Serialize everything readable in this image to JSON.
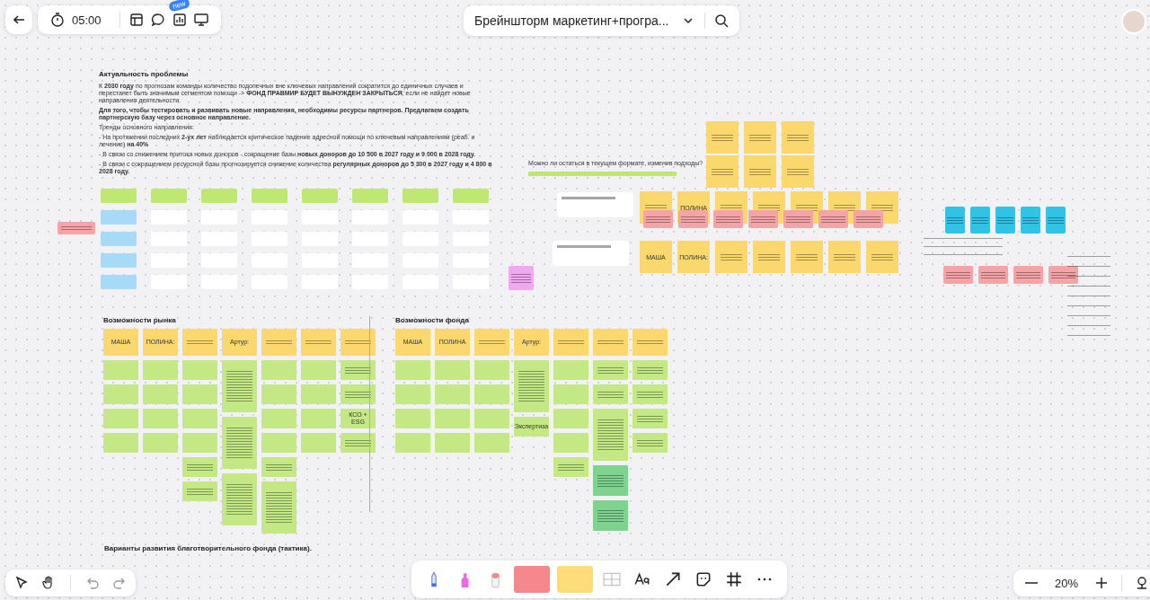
{
  "top_bar": {
    "timer": "05:00",
    "new_badge": "new",
    "board_title": "Брейншторм маркетинг+програ..."
  },
  "problem": {
    "heading": "Актуальность проблемы",
    "paragraphs": [
      "К **2030 году** по прогнозам команды количество подопечных вне ключевых направлений сократится до единичных случаев и перестанет быть значимым сегментом помощи -> **ФОНД ПРАВМИР БУДЕТ ВЫНУЖДЕН ЗАКРЫТЬСЯ**, если не найдет новые направления деятельности.",
      "**Для того, чтобы тестировать и развивать новые направления, необходимы ресурсы партнеров. Предлагаем создать партнерскую базу через основное направление.**",
      "Тренды основного направления:",
      "- На протяжении последних **2-ух лет** наблюдается критическое падение адресной помощи по ключевым направлениям (реаб. и лечение) **на 40%**",
      "- В связи со снижением притока новых доноров - сокращение базы **новых доноров до 10 500 в 2027 году и 9 000 в 2028 году.**",
      "- В связи с сокращением ресурсной базы прогнозируется снижение количества **регулярных доноров до 5 300 в 2027 году и 4 800 в 2028 году.**"
    ]
  },
  "question": {
    "title": "Можно ли остаться в текущем формате, изменив подходы?"
  },
  "market": {
    "heading": "Возможности рынка",
    "columns": [
      {
        "name": "МАША",
        "notes": [
          {
            "kind": "blank"
          },
          {
            "kind": "blank"
          },
          {
            "kind": "blank"
          },
          {
            "kind": "blank"
          }
        ]
      },
      {
        "name": "ПОЛИНА:",
        "notes": [
          {
            "kind": "blank"
          },
          {
            "kind": "blank"
          },
          {
            "kind": "blank"
          },
          {
            "kind": "blank"
          }
        ]
      },
      {
        "notes": [
          {
            "kind": "blank"
          },
          {
            "kind": "blank"
          },
          {
            "kind": "blank"
          },
          {
            "kind": "blank"
          },
          {
            "kind": "scribble"
          },
          {
            "kind": "scribble"
          }
        ]
      },
      {
        "name": "Артур:",
        "notes": [
          {
            "kind": "long"
          },
          {
            "kind": "long"
          },
          {
            "kind": "long"
          }
        ]
      },
      {
        "notes": [
          {
            "kind": "blank"
          },
          {
            "kind": "blank"
          },
          {
            "kind": "blank"
          },
          {
            "kind": "blank"
          },
          {
            "kind": "scribble"
          },
          {
            "kind": "long"
          }
        ]
      },
      {
        "notes": [
          {
            "kind": "blank"
          },
          {
            "kind": "blank"
          },
          {
            "kind": "blank"
          },
          {
            "kind": "blank"
          }
        ]
      },
      {
        "notes": [
          {
            "kind": "scribble"
          },
          {
            "kind": "scribble"
          },
          {
            "kind": "text",
            "text": "КСО + ESG"
          },
          {
            "kind": "scribble"
          }
        ]
      }
    ]
  },
  "fund": {
    "heading": "Возможности фонда",
    "columns": [
      {
        "name": "МАША",
        "notes": [
          {
            "kind": "blank"
          },
          {
            "kind": "blank"
          },
          {
            "kind": "blank"
          },
          {
            "kind": "blank"
          }
        ]
      },
      {
        "name": "ПОЛИНА",
        "notes": [
          {
            "kind": "blank"
          },
          {
            "kind": "blank"
          },
          {
            "kind": "blank"
          },
          {
            "kind": "blank"
          }
        ]
      },
      {
        "notes": [
          {
            "kind": "blank"
          },
          {
            "kind": "blank"
          },
          {
            "kind": "blank"
          },
          {
            "kind": "blank"
          }
        ]
      },
      {
        "name": "Артур:",
        "notes": [
          {
            "kind": "long"
          },
          {
            "kind": "text",
            "text": "Экспертиза"
          }
        ]
      },
      {
        "notes": [
          {
            "kind": "blank"
          },
          {
            "kind": "blank"
          },
          {
            "kind": "blank"
          },
          {
            "kind": "blank"
          },
          {
            "kind": "scribble"
          }
        ]
      },
      {
        "notes": [
          {
            "kind": "scribble"
          },
          {
            "kind": "scribble"
          },
          {
            "kind": "long"
          },
          {
            "kind": "dark"
          },
          {
            "kind": "dark"
          }
        ]
      },
      {
        "notes": [
          {
            "kind": "scribble"
          },
          {
            "kind": "scribble"
          },
          {
            "kind": "scribble"
          },
          {
            "kind": "scribble"
          }
        ]
      }
    ]
  },
  "ideas": {
    "top": [
      {
        "color": "#fbd86e"
      },
      {
        "color": "#fbd86e"
      },
      {
        "color": "#fbd86e"
      },
      {
        "color": "#fbd86e"
      },
      {
        "color": "#fbd86e"
      },
      {
        "color": "#fbd86e"
      }
    ],
    "row_1": [
      {
        "color": "#fbd86e"
      },
      {
        "color": "#fbd86e",
        "text": "ПОЛИНА"
      },
      {
        "color": "#fbd86e"
      },
      {
        "color": "#fbd86e"
      },
      {
        "color": "#fbd86e"
      },
      {
        "color": "#fbd86e"
      },
      {
        "color": "#fbd86e"
      }
    ],
    "row_2": [
      {
        "color": "#f4a3a6"
      },
      {
        "color": "#f4a3a6"
      },
      {
        "color": "#f4a3a6"
      },
      {
        "color": "#f4a3a6"
      },
      {
        "color": "#f4a3a6"
      },
      {
        "color": "#f4a3a6"
      },
      {
        "color": "#f4a3a6"
      }
    ],
    "row_3": [
      {
        "color": "#fbd86e",
        "text": "МАША"
      },
      {
        "color": "#fbd86e",
        "text": "ПОЛИНА:"
      },
      {
        "color": "#fbd86e"
      },
      {
        "color": "#fbd86e"
      },
      {
        "color": "#fbd86e"
      },
      {
        "color": "#fbd86e"
      },
      {
        "color": "#fbd86e"
      }
    ]
  },
  "right": {
    "blue": [
      {
        "color": "#2fc4e6"
      },
      {
        "color": "#2fc4e6"
      },
      {
        "color": "#2fc4e6"
      },
      {
        "color": "#2fc4e6"
      },
      {
        "color": "#2fc4e6"
      }
    ],
    "pink": [
      {
        "color": "#f4a3a6"
      },
      {
        "color": "#f4a3a6"
      },
      {
        "color": "#f4a3a6"
      },
      {
        "color": "#f4a3a6"
      }
    ]
  },
  "tactics": {
    "heading": "Варианты развития благотворительного фонда (тактика)."
  },
  "zoom": {
    "value": "20%"
  }
}
